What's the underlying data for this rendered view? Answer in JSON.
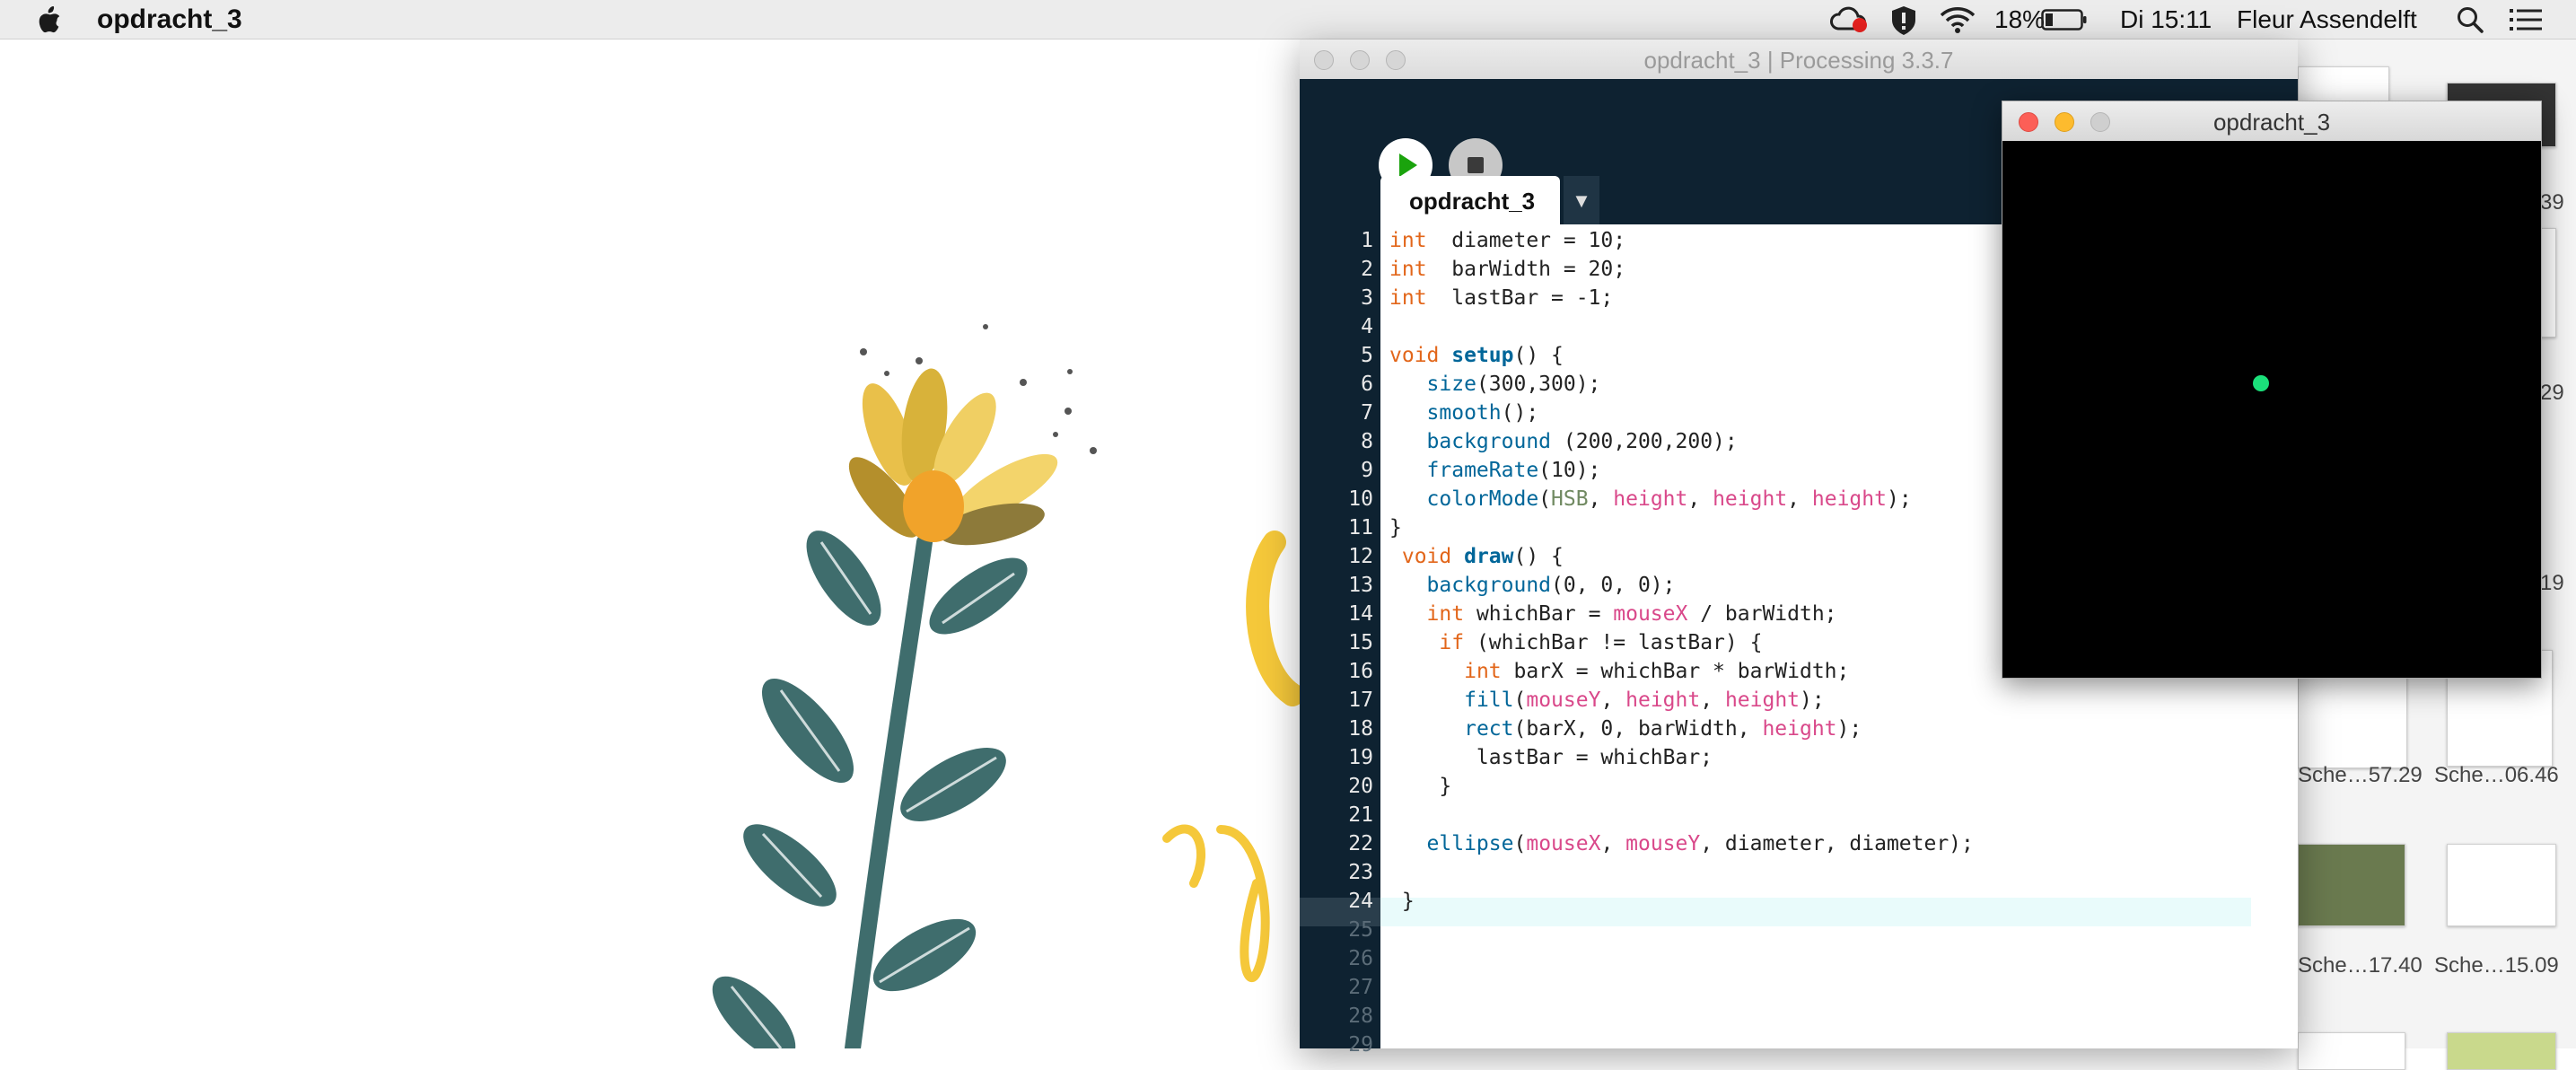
{
  "menubar": {
    "app_name": "opdracht_3",
    "battery": "18%",
    "clock": "Di 15:11",
    "user": "Fleur Assendelft",
    "icons": [
      "apple-icon",
      "creative-cloud-icon",
      "shield-icon",
      "wifi-icon",
      "battery-icon",
      "search-icon",
      "list-icon"
    ]
  },
  "ide": {
    "title": "opdracht_3 | Processing 3.3.7",
    "tab": "opdracht_3",
    "tab_menu": "▼",
    "line_numbers": [
      "1",
      "2",
      "3",
      "4",
      "5",
      "6",
      "7",
      "8",
      "9",
      "10",
      "11",
      "12",
      "13",
      "14",
      "15",
      "16",
      "17",
      "18",
      "19",
      "20",
      "21",
      "22",
      "23",
      "24",
      "25",
      "26",
      "27",
      "28",
      "29"
    ]
  },
  "sketch": {
    "title": "opdracht_3",
    "background": "#000000",
    "dot_color": "#1be07a"
  },
  "thumbnails": {
    "labels": [
      "39",
      "29",
      "19",
      "Sche…57.29",
      "Sche…06.46",
      "Sche…17.40",
      "Sche…15.09"
    ]
  }
}
